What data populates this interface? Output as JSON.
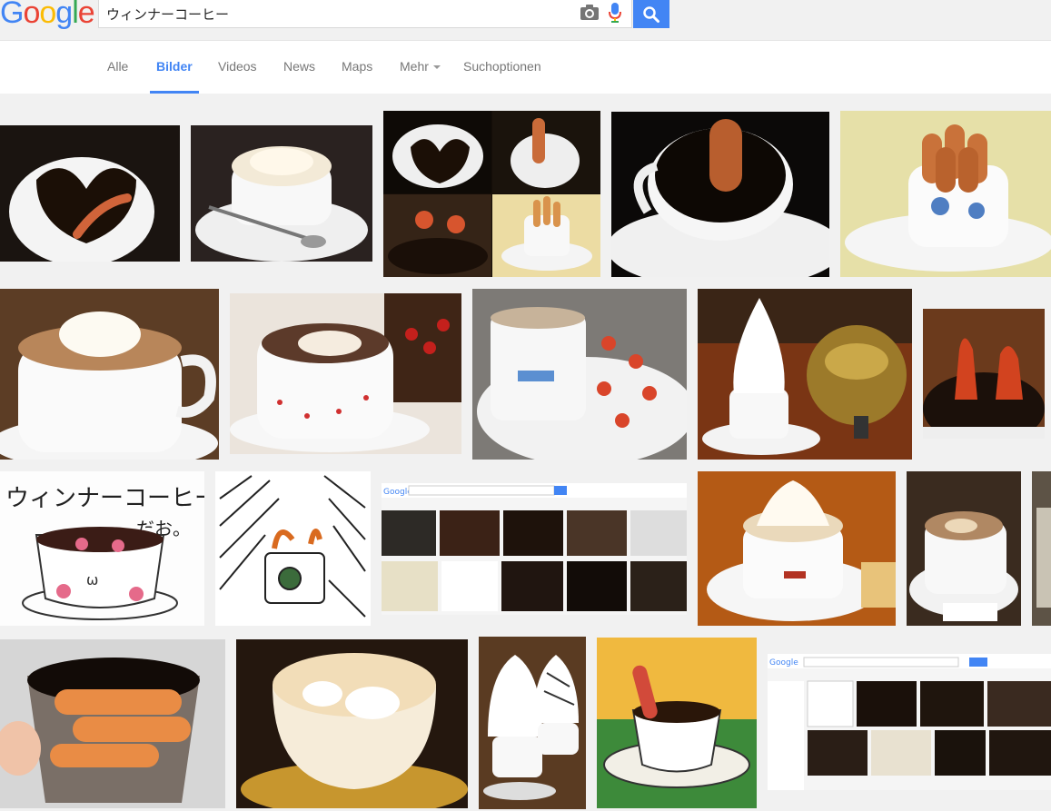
{
  "header": {
    "logo_letters": [
      {
        "char": "G",
        "color": "#4285f4"
      },
      {
        "char": "o",
        "color": "#ea4335"
      },
      {
        "char": "o",
        "color": "#fbbc05"
      },
      {
        "char": "g",
        "color": "#4285f4"
      },
      {
        "char": "l",
        "color": "#34a853"
      },
      {
        "char": "e",
        "color": "#ea4335"
      }
    ],
    "search_query": "ウィンナーコーヒー",
    "camera_icon": "camera-icon",
    "mic_icon": "microphone-icon",
    "search_icon": "magnifier-icon",
    "accent_color": "#4285f4"
  },
  "tabs": {
    "all": "Alle",
    "images": "Bilder",
    "videos": "Videos",
    "news": "News",
    "maps": "Maps",
    "more": "Mehr",
    "options": "Suchoptionen"
  },
  "results": {
    "thumbnails": [
      "coffee with sausage in heart-shaped cup",
      "cappuccino with cream and spoon",
      "collage of sausage coffee",
      "black coffee with sausage",
      "sausages in blue floral cup",
      "coffee with whipped cream, polka dot background",
      "red polka dot cup with cream",
      "coffee with octopus sausages",
      "soft-serve cream coffee with teapot",
      "octopus sausages in coffee",
      "drawing of cup with octopus sausages",
      "sketch of cup with sausage",
      "screenshot of image search",
      "cream coffee with spoon",
      "coffee with cream in saucer",
      "partial image",
      "sausages in coffee mug",
      "cream coffee in ornate cup",
      "tall whipped cream coffees",
      "painting of coffee with sausage",
      "screenshot of image search"
    ]
  }
}
